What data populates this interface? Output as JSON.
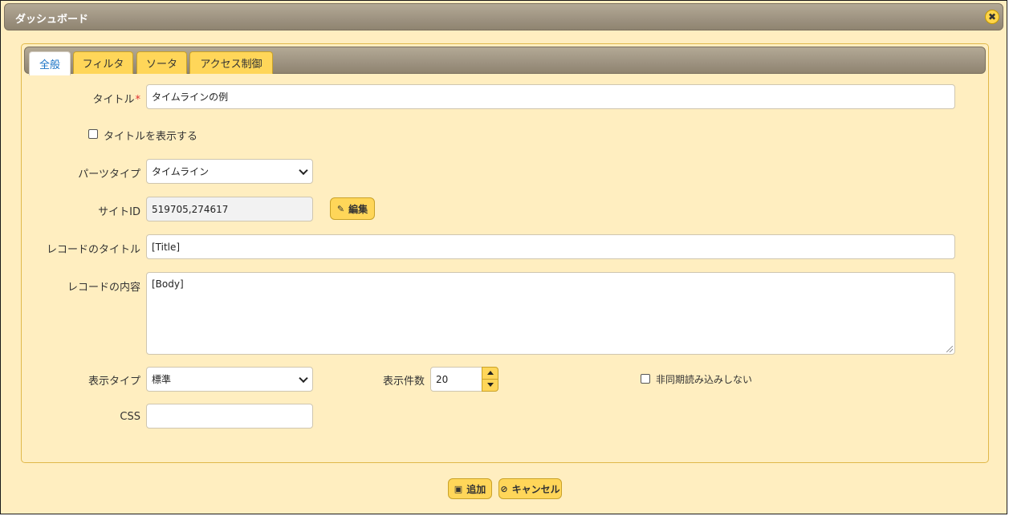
{
  "dialog": {
    "title": "ダッシュボード"
  },
  "tabs": [
    {
      "label": "全般",
      "active": true
    },
    {
      "label": "フィルタ",
      "active": false
    },
    {
      "label": "ソータ",
      "active": false
    },
    {
      "label": "アクセス制御",
      "active": false
    }
  ],
  "form": {
    "title_label": "タイトル",
    "required_mark": "*",
    "title_value": "タイムラインの例",
    "show_title_label": "タイトルを表示する",
    "show_title_checked": false,
    "parts_type_label": "パーツタイプ",
    "parts_type_value": "タイムライン",
    "site_id_label": "サイトID",
    "site_id_value": "519705,274617",
    "edit_button": "編集",
    "record_title_label": "レコードのタイトル",
    "record_title_value": "[Title]",
    "record_body_label": "レコードの内容",
    "record_body_value": "[Body]",
    "display_type_label": "表示タイプ",
    "display_type_value": "標準",
    "display_count_label": "表示件数",
    "display_count_value": "20",
    "no_async_label": "非同期読み込みしない",
    "no_async_checked": false,
    "css_label": "CSS",
    "css_value": ""
  },
  "footer": {
    "add_button": "追加",
    "cancel_button": "キャンセル"
  },
  "colors": {
    "accent": "#ffd659",
    "panel_bg": "#ffeec0",
    "titlebar": "#9d9280",
    "active_tab_text": "#1a73c5",
    "required": "#e03030"
  }
}
